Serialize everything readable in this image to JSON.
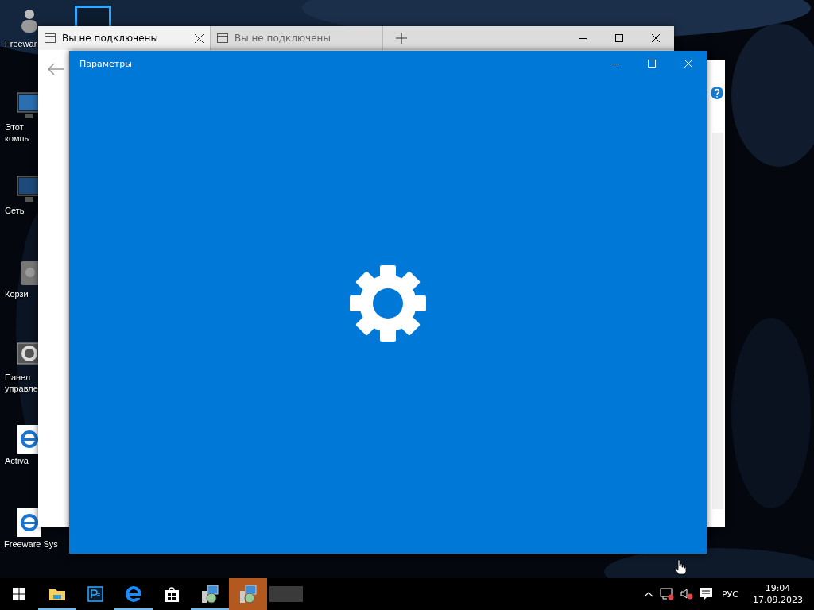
{
  "desktop_icons": [
    {
      "kind": "user",
      "label": "Freewar"
    },
    {
      "kind": "computer",
      "label": "Этот компь"
    },
    {
      "kind": "network",
      "label": "Сеть"
    },
    {
      "kind": "bin",
      "label": "Корзи"
    },
    {
      "kind": "panel",
      "label": "Панел управле"
    },
    {
      "kind": "edge",
      "label": "Activa"
    },
    {
      "kind": "edge",
      "label": "Freeware Sys"
    }
  ],
  "browser": {
    "tabs": [
      {
        "label": "Вы не подключены",
        "selected": true
      },
      {
        "label": "Вы не подключены",
        "selected": false
      }
    ]
  },
  "settings_window": {
    "title": "Параметры"
  },
  "taskbar": {
    "apps": [
      {
        "kind": "explorer",
        "running": true,
        "selected": false
      },
      {
        "kind": "photoshop",
        "running": false,
        "selected": false
      },
      {
        "kind": "edge",
        "running": true,
        "selected": false
      },
      {
        "kind": "store",
        "running": false,
        "selected": false
      },
      {
        "kind": "installer",
        "running": true,
        "selected": false
      },
      {
        "kind": "installer",
        "running": false,
        "selected": true
      },
      {
        "kind": "blank",
        "running": false,
        "selected": false
      }
    ],
    "language": "РУС",
    "time": "19:04",
    "date": "17.09.2023"
  }
}
